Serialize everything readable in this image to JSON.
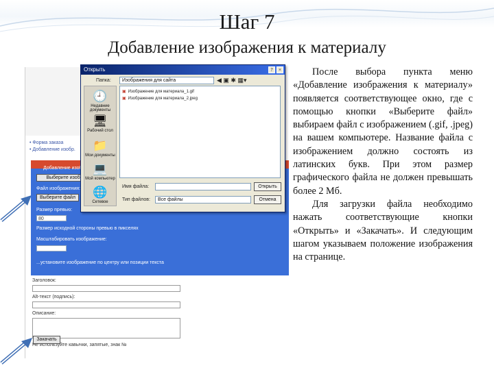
{
  "slide": {
    "title": "Шаг 7",
    "subtitle": "Добавление изображения к материалу"
  },
  "description": {
    "paragraph1": "После выбора пункта меню «Добавление изображения к материалу» появляется соответствующее окно, где с помощью кнопки «Выберите файл» выбираем файл с изображением (.gif, .jpeg) на вашем компьютере. Название файла с изображением должно состоять из латинских букв. При этом размер графического файла не должен превышать более 2 Мб.",
    "paragraph2": "Для загрузки файла необходимо нажать соответствующие кнопки «Открыть» и «Закачать». И следующим шагом указываем положение изображения на странице."
  },
  "screenshot": {
    "page_links": [
      "• Форма заказа",
      "• Добавление изобр."
    ],
    "panel_header": "Добавление изобр.",
    "panel": {
      "browse_label": "Выберите изобр.",
      "file_label": "Файл изображения:",
      "choose_file_button": "Выберите файл",
      "size_label": "Размер превью:",
      "size_value": "80",
      "resize_label": "Размер исходной стороны превью в пикселях",
      "scale_label": "Масштабировать изображение:",
      "bottom_note": "...установите изображение по центру или позиции текста"
    },
    "lower": {
      "title_label": "Заголовок:",
      "alt_label": "Alt-текст (подпись):",
      "desc_label": "Описание:",
      "note": "Не используйте кавычки, запятые, знак №",
      "upload_button": "Закачать"
    },
    "dialog": {
      "title": "Открыть",
      "folder_label": "Папка:",
      "folder_value": "Изображения для сайта",
      "files": [
        "Изображение для материала_1.gif",
        "Изображение для материала_2.jpeg"
      ],
      "places": [
        "Недавние документы",
        "Рабочий стол",
        "Мои документы",
        "Мой компьютер",
        "Сетевое"
      ],
      "filename_label": "Имя файла:",
      "filetype_label": "Тип файлов:",
      "filetype_value": "Все файлы",
      "open_button": "Открыть",
      "cancel_button": "Отмена"
    }
  },
  "colors": {
    "panel_blue": "#3a6fd8",
    "panel_header_red": "#d64a2e",
    "dialog_title_blue": "#0a246a",
    "arrow_blue": "#3f6fb5"
  }
}
